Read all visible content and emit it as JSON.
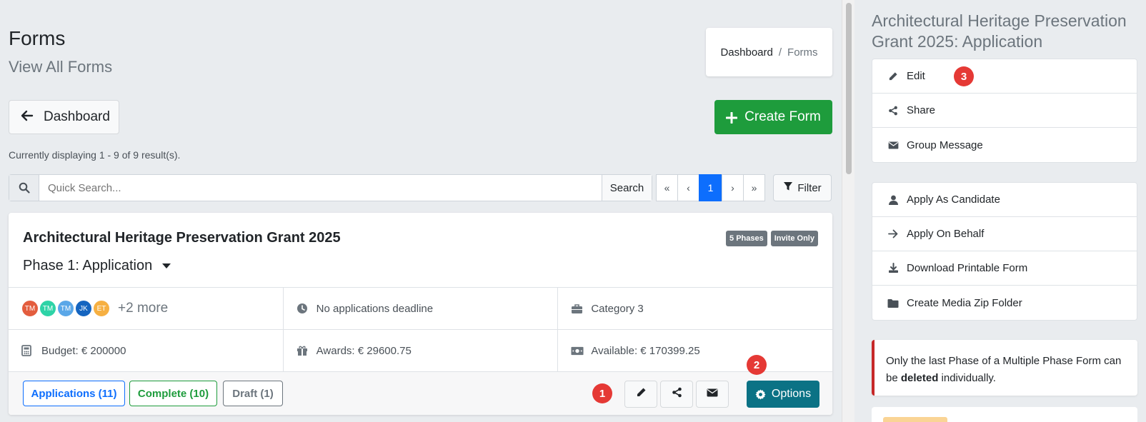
{
  "header": {
    "title": "Forms",
    "subtitle": "View All Forms"
  },
  "breadcrumb": {
    "home": "Dashboard",
    "separator": "/",
    "current": "Forms"
  },
  "toolbar": {
    "back_label": "Dashboard",
    "create_label": "Create Form"
  },
  "results_text": "Currently displaying 1 - 9 of 9 result(s).",
  "search": {
    "placeholder": "Quick Search...",
    "button_label": "Search",
    "filter_label": "Filter"
  },
  "pagination": {
    "first": "«",
    "prev": "‹",
    "current": "1",
    "next": "›",
    "last": "»"
  },
  "form_card": {
    "title": "Architectural Heritage Preservation Grant 2025",
    "badges": [
      "5 Phases",
      "Invite Only"
    ],
    "phase_label": "Phase 1: Application",
    "avatars": [
      {
        "initials": "TM",
        "color": "#e35d3e"
      },
      {
        "initials": "TM",
        "color": "#2ed3a7"
      },
      {
        "initials": "TM",
        "color": "#5aa7e8"
      },
      {
        "initials": "JK",
        "color": "#1565c0"
      },
      {
        "initials": "ET",
        "color": "#f6b042"
      }
    ],
    "avatars_more": "+2 more",
    "deadline": "No applications deadline",
    "category": "Category 3",
    "budget": "Budget: € 200000",
    "awards": "Awards: € 29600.75",
    "available": "Available: € 170399.25",
    "footer": {
      "applications": "Applications (11)",
      "complete": "Complete (10)",
      "draft": "Draft (1)",
      "options_label": "Options"
    }
  },
  "annotations": {
    "one": "1",
    "two": "2",
    "three": "3"
  },
  "side_panel": {
    "title": "Architectural Heritage Preservation Grant 2025: Application",
    "group1": [
      "Edit",
      "Share",
      "Group Message"
    ],
    "group2": [
      "Apply As Candidate",
      "Apply On Behalf",
      "Download Printable Form",
      "Create Media Zip Folder"
    ],
    "alert_pre": "Only the last Phase of a Multiple Phase Form can be ",
    "alert_bold": "deleted",
    "alert_post": " individually."
  },
  "colors": {
    "primary": "#0d6efd",
    "success": "#1e9c3c",
    "options": "#0b7285",
    "danger": "#e53935"
  }
}
